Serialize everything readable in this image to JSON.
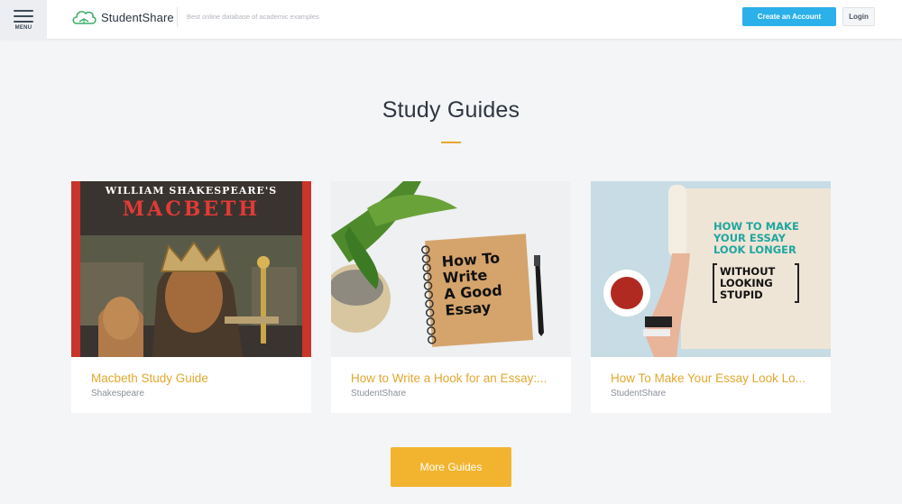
{
  "header": {
    "menu_label": "MENU",
    "logo_text": "StudentShare",
    "tagline": "Best online database of academic examples",
    "create_account_label": "Create an Account",
    "login_label": "Login",
    "accent_color": "#2bb0ea"
  },
  "main": {
    "title": "Study Guides",
    "underline_color": "#e3a72f",
    "cards": [
      {
        "title": "Macbeth Study Guide",
        "subtitle": "Shakespeare",
        "image": {
          "line1": "WILLIAM SHAKESPEARE'S",
          "line2": "MACBETH"
        }
      },
      {
        "title": "How to Write a Hook for an Essay:...",
        "subtitle": "StudentShare",
        "image": {
          "line1": "How To",
          "line2": "Write",
          "line3": "A Good",
          "line4": "Essay"
        }
      },
      {
        "title": "How To Make Your Essay Look Lo...",
        "subtitle": "StudentShare",
        "image": {
          "line1": "HOW TO MAKE",
          "line2": "YOUR ESSAY",
          "line3": "LOOK LONGER",
          "line4": "WITHOUT",
          "line5": "LOOKING",
          "line6": "STUPID"
        }
      }
    ],
    "more_button_label": "More Guides",
    "more_button_color": "#f2b42f"
  }
}
